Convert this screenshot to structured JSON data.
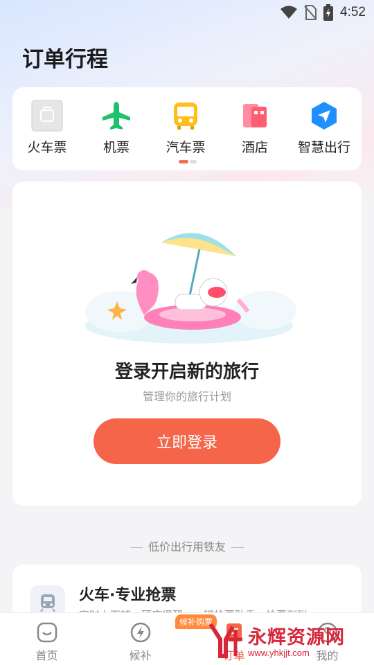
{
  "status_bar": {
    "time": "4:52",
    "icons": [
      "wifi-icon",
      "no-sim-icon",
      "battery-charging-icon"
    ]
  },
  "page_title": "订单行程",
  "quick_links": [
    {
      "label": "火车票",
      "icon": "train-ticket-icon"
    },
    {
      "label": "机票",
      "icon": "plane-icon"
    },
    {
      "label": "汽车票",
      "icon": "bus-icon"
    },
    {
      "label": "酒店",
      "icon": "hotel-icon"
    },
    {
      "label": "智慧出行",
      "icon": "navigation-icon"
    }
  ],
  "empty_state": {
    "heading": "登录开启新的旅行",
    "subtext": "管理你的旅行计划",
    "login_button": "立即登录"
  },
  "divider": "低价出行用铁友",
  "promo": {
    "title": "火车·专业抢票",
    "subtitle": "实时上下铺、硬座提醒、一键抢票助手，抢票到账"
  },
  "tabbar": {
    "items": [
      {
        "label": "首页",
        "icon": "home-icon"
      },
      {
        "label": "候补",
        "icon": "lightning-circle-icon",
        "badge": "候补购票"
      },
      {
        "label": "订单",
        "icon": "order-icon",
        "active": true
      },
      {
        "label": "我的",
        "icon": "profile-icon"
      }
    ]
  },
  "watermark": {
    "text": "永辉资源网",
    "url": "www.yhkjjt.com"
  },
  "colors": {
    "accent": "#f4654a",
    "badge": "#ff8a3d",
    "watermark": "#d8263a"
  }
}
